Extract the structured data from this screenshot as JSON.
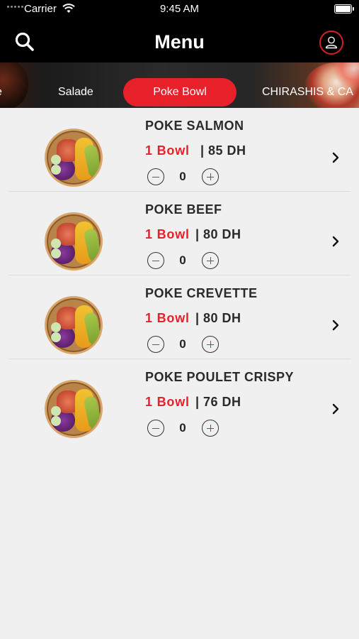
{
  "status_bar": {
    "carrier": "Carrier",
    "time": "9:45 AM"
  },
  "header": {
    "title": "Menu",
    "tabs": [
      {
        "label": "e",
        "active": false
      },
      {
        "label": "Salade",
        "active": false
      },
      {
        "label": "Poke Bowl",
        "active": true
      },
      {
        "label": "CHIRASHIS & CA",
        "active": false
      }
    ]
  },
  "colors": {
    "accent": "#e8202a",
    "header_bg": "#000000",
    "list_bg": "#f0f0f0"
  },
  "items": [
    {
      "name": "POKE SALMON",
      "unit": "1 Bowl",
      "price": "| 85 DH",
      "quantity": "0"
    },
    {
      "name": "POKE BEEF",
      "unit": "1 Bowl",
      "price": "| 80 DH",
      "quantity": "0"
    },
    {
      "name": "POKE CREVETTE",
      "unit": "1 Bowl",
      "price": "| 80 DH",
      "quantity": "0"
    },
    {
      "name": "POKE POULET CRISPY",
      "unit": "1 Bowl",
      "price": "| 76 DH",
      "quantity": "0"
    }
  ],
  "icons": {
    "search": "search-icon",
    "profile": "user-icon",
    "chevron": "chevron-right-icon",
    "minus": "minus-icon",
    "plus": "plus-icon"
  }
}
